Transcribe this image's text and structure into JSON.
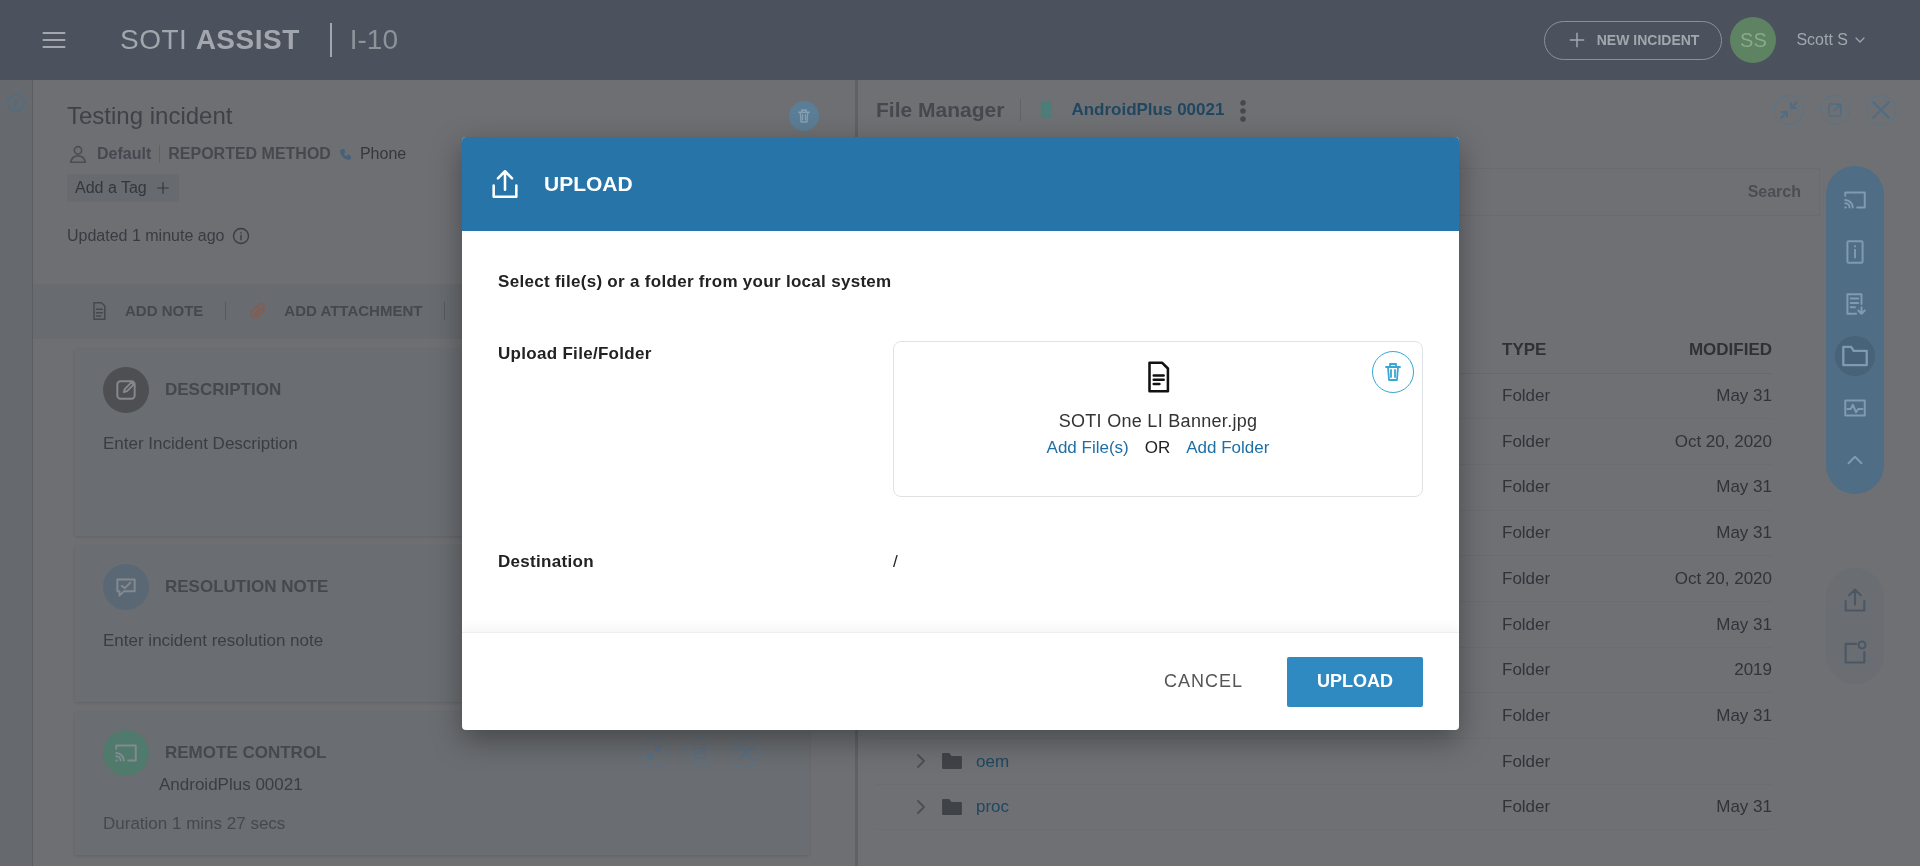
{
  "top_bar": {
    "logo": "SOTI **ASSIST**",
    "incident_id": "I-10",
    "new_incident_button": "NEW INCIDENT",
    "avatar_initials": "SS",
    "user_name": "Scott S"
  },
  "incident": {
    "title": "Testing incident",
    "assignee": "Default",
    "reported_method_label": "REPORTED METHOD",
    "reported_method": "Phone",
    "add_tag": "Add a Tag",
    "updated": "Updated 1 minute ago",
    "actions": [
      {
        "kind": "note",
        "label": "ADD NOTE"
      },
      {
        "kind": "attachment",
        "label": "ADD ATTACHMENT"
      }
    ],
    "sections": [
      {
        "kind": "description",
        "title": "DESCRIPTION",
        "placeholder": "Enter Incident Description"
      },
      {
        "kind": "resolution",
        "title": "RESOLUTION NOTE",
        "placeholder": "Enter incident resolution note"
      },
      {
        "kind": "remote",
        "title": "REMOTE CONTROL",
        "device": "AndroidPlus 00021",
        "duration": "Duration 1 mins 27 secs"
      }
    ]
  },
  "file_manager": {
    "title": "File Manager",
    "device": "AndroidPlus 00021",
    "search_button": "Search",
    "columns": [
      "TYPE",
      "MODIFIED"
    ],
    "rows": [
      {
        "type": "Folder",
        "modified": "May 31"
      },
      {
        "type": "Folder",
        "modified": "Oct 20, 2020"
      },
      {
        "type": "Folder",
        "modified": "May 31"
      },
      {
        "type": "Folder",
        "modified": "May 31"
      },
      {
        "type": "Folder",
        "modified": "Oct 20, 2020"
      },
      {
        "type": "Folder",
        "modified": "May 31"
      },
      {
        "type": "Folder",
        "modified": "2019"
      },
      {
        "type": "Folder",
        "modified": "May 31"
      },
      {
        "name": "oem",
        "type": "Folder"
      },
      {
        "name": "proc",
        "type": "Folder",
        "modified": "May 31"
      }
    ],
    "side_tools": [
      {
        "kind": "cast",
        "selected": false
      },
      {
        "kind": "info",
        "selected": false
      },
      {
        "kind": "log",
        "selected": false
      },
      {
        "kind": "folder",
        "selected": true
      },
      {
        "kind": "monitor",
        "selected": false
      },
      {
        "kind": "collapse",
        "selected": false
      }
    ],
    "extra_tools": [
      {
        "kind": "upload"
      },
      {
        "kind": "new-item"
      }
    ]
  },
  "upload_dialog": {
    "title": "UPLOAD",
    "intro": "Select file(s) or a folder from your local system",
    "file_label": "Upload File/Folder",
    "file_name": "SOTI One LI Banner.jpg",
    "add_files": "Add File(s)",
    "or": "OR",
    "add_folder": "Add Folder",
    "destination_label": "Destination",
    "destination": "/",
    "cancel_button": "CANCEL",
    "upload_button": "UPLOAD"
  }
}
